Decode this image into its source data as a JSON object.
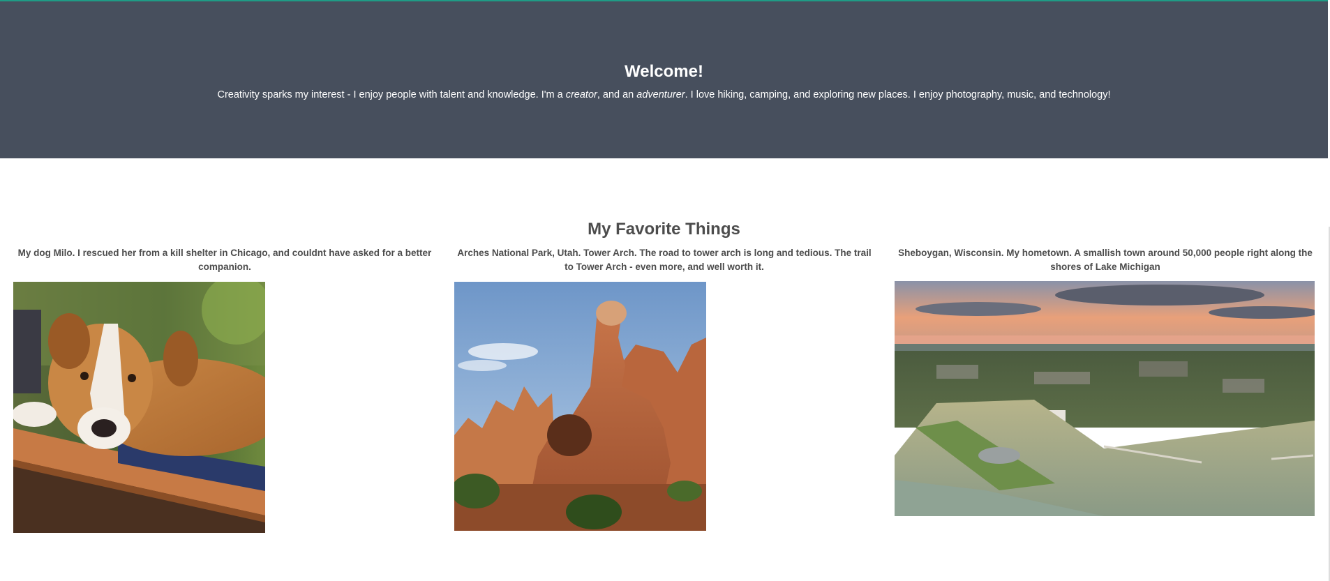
{
  "hero": {
    "title": "Welcome!",
    "text_1": "Creativity sparks my interest - I enjoy people with talent and knowledge. I'm a ",
    "em_1": "creator",
    "text_2": ", and an ",
    "em_2": "adventurer",
    "text_3": ". I love hiking, camping, and exploring new places. I enjoy photography, music, and technology!"
  },
  "favorites": {
    "title": "My Favorite Things",
    "items": [
      {
        "caption": "My dog Milo. I rescued her from a kill shelter in Chicago, and couldnt have asked for a better companion.",
        "image": "dog-photo"
      },
      {
        "caption": "Arches National Park, Utah. Tower Arch. The road to tower arch is long and tedious. The trail to Tower Arch - even more, and well worth it.",
        "image": "arches-photo"
      },
      {
        "caption": "Sheboygan, Wisconsin. My hometown. A smallish town around 50,000 people right along the shores of Lake Michigan",
        "image": "sheboygan-photo"
      }
    ]
  },
  "colors": {
    "hero_bg": "#474f5d",
    "accent_line": "#1f9c86",
    "heading_text": "#4c4c4c"
  }
}
